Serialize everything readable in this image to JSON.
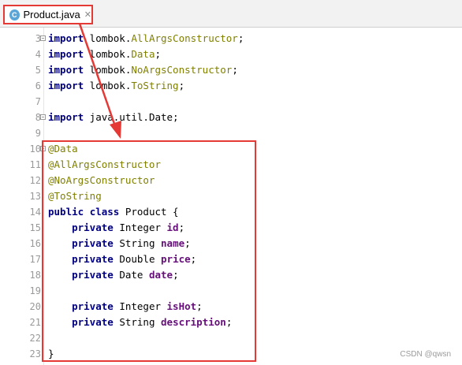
{
  "tab": {
    "label": "Product.java",
    "icon": "java-class-icon",
    "close": "✕",
    "icon_letter": "C"
  },
  "lines": [
    {
      "n": "3",
      "tokens": [
        {
          "t": "import",
          "c": "kw"
        },
        {
          "t": " lombok.",
          "c": "plain"
        },
        {
          "t": "AllArgsConstructor",
          "c": "anno"
        },
        {
          "t": ";",
          "c": "punct"
        }
      ]
    },
    {
      "n": "4",
      "tokens": [
        {
          "t": "import",
          "c": "kw"
        },
        {
          "t": " lombok.",
          "c": "plain"
        },
        {
          "t": "Data",
          "c": "anno"
        },
        {
          "t": ";",
          "c": "punct"
        }
      ]
    },
    {
      "n": "5",
      "tokens": [
        {
          "t": "import",
          "c": "kw"
        },
        {
          "t": " lombok.",
          "c": "plain"
        },
        {
          "t": "NoArgsConstructor",
          "c": "anno"
        },
        {
          "t": ";",
          "c": "punct"
        }
      ]
    },
    {
      "n": "6",
      "tokens": [
        {
          "t": "import",
          "c": "kw"
        },
        {
          "t": " lombok.",
          "c": "plain"
        },
        {
          "t": "ToString",
          "c": "anno"
        },
        {
          "t": ";",
          "c": "punct"
        }
      ]
    },
    {
      "n": "7",
      "tokens": []
    },
    {
      "n": "8",
      "tokens": [
        {
          "t": "import",
          "c": "kw"
        },
        {
          "t": " java.util.Date;",
          "c": "plain"
        }
      ]
    },
    {
      "n": "9",
      "tokens": []
    },
    {
      "n": "10",
      "tokens": [
        {
          "t": "@Data",
          "c": "anno"
        }
      ]
    },
    {
      "n": "11",
      "tokens": [
        {
          "t": "@AllArgsConstructor",
          "c": "anno"
        }
      ]
    },
    {
      "n": "12",
      "tokens": [
        {
          "t": "@NoArgsConstructor",
          "c": "anno"
        }
      ]
    },
    {
      "n": "13",
      "tokens": [
        {
          "t": "@ToString",
          "c": "anno"
        }
      ]
    },
    {
      "n": "14",
      "tokens": [
        {
          "t": "public",
          "c": "kw"
        },
        {
          "t": " ",
          "c": "plain"
        },
        {
          "t": "class",
          "c": "kw"
        },
        {
          "t": " Product {",
          "c": "plain"
        }
      ]
    },
    {
      "n": "15",
      "tokens": [
        {
          "t": "    ",
          "c": "plain"
        },
        {
          "t": "private",
          "c": "kw"
        },
        {
          "t": " Integer ",
          "c": "plain"
        },
        {
          "t": "id",
          "c": "field"
        },
        {
          "t": ";",
          "c": "punct"
        }
      ]
    },
    {
      "n": "16",
      "tokens": [
        {
          "t": "    ",
          "c": "plain"
        },
        {
          "t": "private",
          "c": "kw"
        },
        {
          "t": " String ",
          "c": "plain"
        },
        {
          "t": "name",
          "c": "field"
        },
        {
          "t": ";",
          "c": "punct"
        }
      ]
    },
    {
      "n": "17",
      "tokens": [
        {
          "t": "    ",
          "c": "plain"
        },
        {
          "t": "private",
          "c": "kw"
        },
        {
          "t": " Double ",
          "c": "plain"
        },
        {
          "t": "price",
          "c": "field"
        },
        {
          "t": ";",
          "c": "punct"
        }
      ]
    },
    {
      "n": "18",
      "tokens": [
        {
          "t": "    ",
          "c": "plain"
        },
        {
          "t": "private",
          "c": "kw"
        },
        {
          "t": " Date ",
          "c": "plain"
        },
        {
          "t": "date",
          "c": "field"
        },
        {
          "t": ";",
          "c": "punct"
        }
      ]
    },
    {
      "n": "19",
      "tokens": []
    },
    {
      "n": "20",
      "tokens": [
        {
          "t": "    ",
          "c": "plain"
        },
        {
          "t": "private",
          "c": "kw"
        },
        {
          "t": " Integer ",
          "c": "plain"
        },
        {
          "t": "isHot",
          "c": "field"
        },
        {
          "t": ";",
          "c": "punct"
        }
      ]
    },
    {
      "n": "21",
      "tokens": [
        {
          "t": "    ",
          "c": "plain"
        },
        {
          "t": "private",
          "c": "kw"
        },
        {
          "t": " String ",
          "c": "plain"
        },
        {
          "t": "description",
          "c": "field"
        },
        {
          "t": ";",
          "c": "punct"
        }
      ]
    },
    {
      "n": "22",
      "tokens": []
    },
    {
      "n": "23",
      "tokens": [
        {
          "t": "}",
          "c": "plain"
        }
      ]
    }
  ],
  "watermark": "CSDN @qwsn",
  "colors": {
    "annotation_box": "#e53935",
    "arrow": "#e53935",
    "keyword": "#000080",
    "annotation": "#808000",
    "field": "#660e7a"
  }
}
